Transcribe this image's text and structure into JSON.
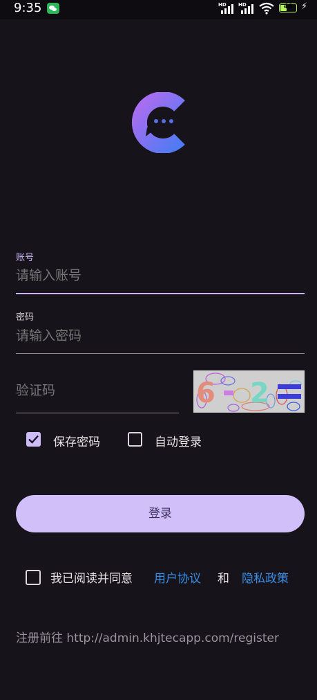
{
  "status_bar": {
    "time": "9:35",
    "signal1_label": "HD",
    "signal2_label": "HD",
    "battery": "46",
    "battery_level": 0.46
  },
  "form": {
    "account": {
      "label": "账号",
      "placeholder": "请输入账号"
    },
    "password": {
      "label": "密码",
      "placeholder": "请输入密码"
    },
    "captcha": {
      "placeholder": "验证码",
      "image_text": "6 - 2 ="
    }
  },
  "options": {
    "save_password": {
      "label": "保存密码",
      "checked": true
    },
    "auto_login": {
      "label": "自动登录",
      "checked": false
    }
  },
  "login_button": "登录",
  "agreement": {
    "prefix": "我已阅读并同意",
    "user_agreement": "用户协议",
    "and": "和",
    "privacy_policy": "隐私政策",
    "checked": false
  },
  "register": {
    "prefix": "注册前往",
    "url": "http://admin.khjtecapp.com/register"
  },
  "colors": {
    "background": "#16131a",
    "accent": "#d1bffa",
    "link": "#3a8ee6",
    "logo_gradient_start": "#b06cf0",
    "logo_gradient_end": "#4d7bf3"
  }
}
